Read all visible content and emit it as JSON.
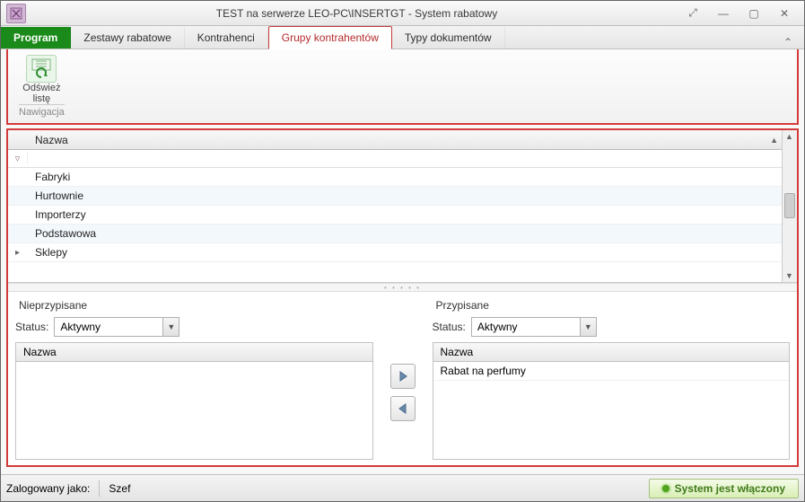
{
  "window": {
    "title": "TEST na serwerze LEO-PC\\INSERTGT - System rabatowy"
  },
  "tabs": {
    "program": "Program",
    "items": [
      "Zestawy rabatowe",
      "Kontrahenci",
      "Grupy kontrahentów",
      "Typy dokumentów"
    ],
    "active_index": 2
  },
  "ribbon": {
    "refresh_label_line1": "Odśwież",
    "refresh_label_line2": "listę",
    "group_label": "Nawigacja"
  },
  "grid": {
    "column_header": "Nazwa",
    "rows": [
      "Fabryki",
      "Hurtownie",
      "Importerzy",
      "Podstawowa",
      "Sklepy"
    ],
    "selected_index": 4
  },
  "panels": {
    "left": {
      "title": "Nieprzypisane",
      "status_label": "Status:",
      "status_value": "Aktywny",
      "list_header": "Nazwa",
      "items": []
    },
    "right": {
      "title": "Przypisane",
      "status_label": "Status:",
      "status_value": "Aktywny",
      "list_header": "Nazwa",
      "items": [
        "Rabat na perfumy"
      ]
    }
  },
  "statusbar": {
    "logged_label": "Zalogowany jako:",
    "user": "Szef",
    "system_status": "System jest włączony"
  }
}
